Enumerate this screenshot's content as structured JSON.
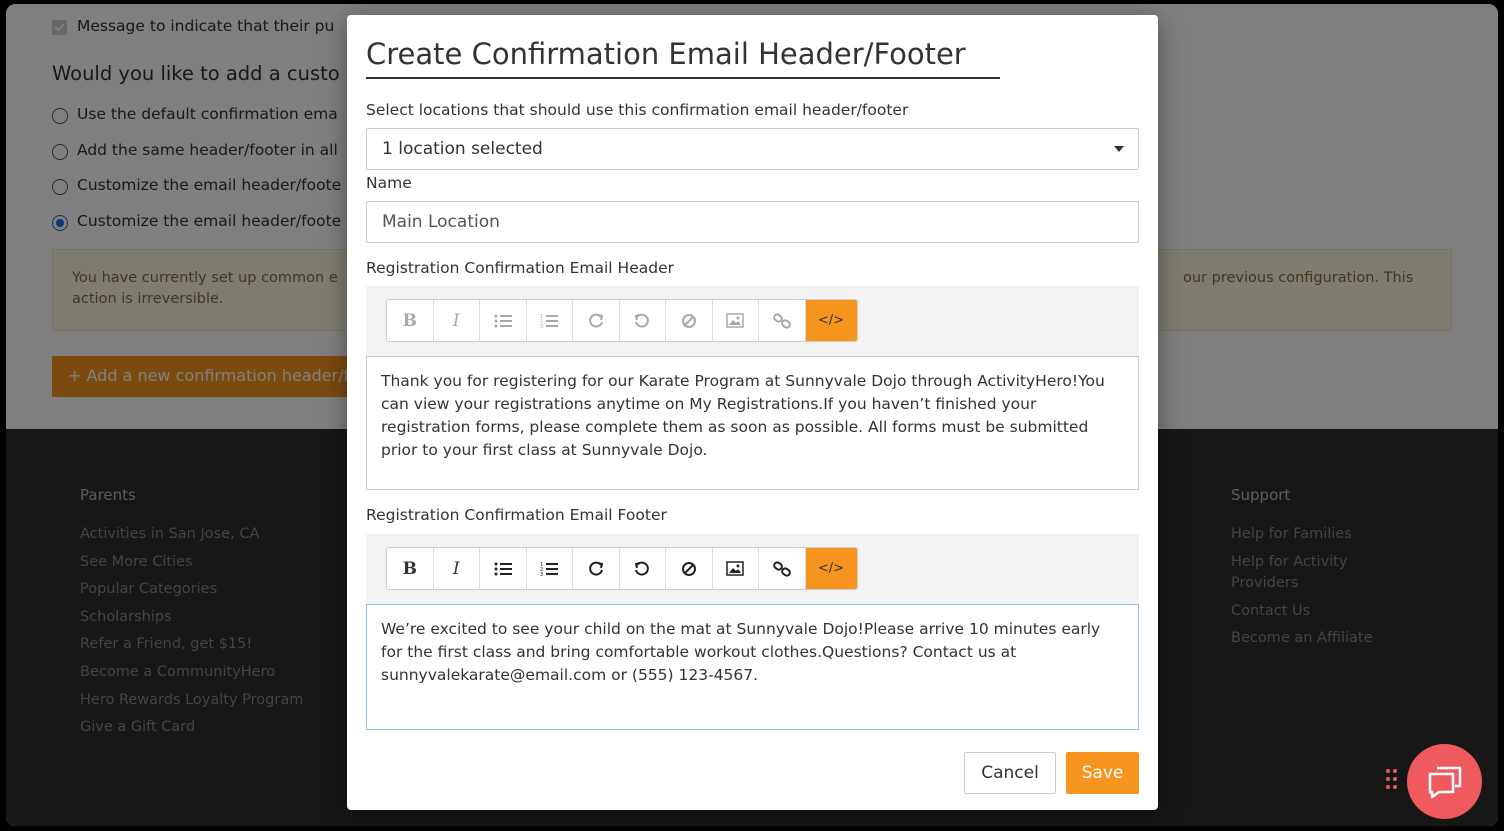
{
  "background": {
    "checkbox_label": "Message to indicate that their pu",
    "question": "Would you like to add a custo",
    "radio_options": [
      "Use the default confirmation ema",
      "Add the same header/footer in all",
      "Customize the email header/foote",
      "Customize the email header/foote"
    ],
    "alert_line1_left": "You have currently set up common e",
    "alert_line1_right": "our previous configuration. This",
    "alert_line2": "action is irreversible.",
    "add_button": "+ Add a new confirmation header/f",
    "footer": {
      "parents_heading": "Parents",
      "parents_links": [
        "Activities in San Jose, CA",
        "See More Cities",
        "Popular Categories",
        "Scholarships",
        "Refer a Friend, get $15!",
        "Become a CommunityHero",
        "Hero Rewards Loyalty Program",
        "Give a Gift Card"
      ],
      "support_heading": "Support",
      "support_links": [
        "Help for Families",
        "Help for Activity",
        "Providers",
        "Contact Us",
        "Become an Affiliate"
      ]
    }
  },
  "modal": {
    "title": "Create Confirmation Email Header/Footer",
    "locations_label": "Select locations that should use this confirmation email header/footer",
    "locations_value": "1 location selected",
    "name_label": "Name",
    "name_value": "Main Location",
    "header_label": "Registration Confirmation Email Header",
    "header_text": "Thank you for registering for our Karate Program at Sunnyvale Dojo through ActivityHero!You can view your registrations anytime on My Registrations.If you haven’t finished your registration forms, please complete them as soon as possible. All forms must be submitted prior to your first class at Sunnyvale Dojo.",
    "footer_label": "Registration Confirmation Email Footer",
    "footer_text": "We’re excited to see your child on the mat at Sunnyvale Dojo!Please arrive 10 minutes early for the first class and bring comfortable workout clothes.Questions? Contact us at sunnyvalekarate@email.com or (555) 123-4567.",
    "toolbar_bold": "B",
    "toolbar_italic": "I",
    "toolbar_code": "</>",
    "cancel_label": "Cancel",
    "save_label": "Save"
  },
  "colors": {
    "accent": "#f7941d",
    "chat": "#ef5a5f"
  }
}
